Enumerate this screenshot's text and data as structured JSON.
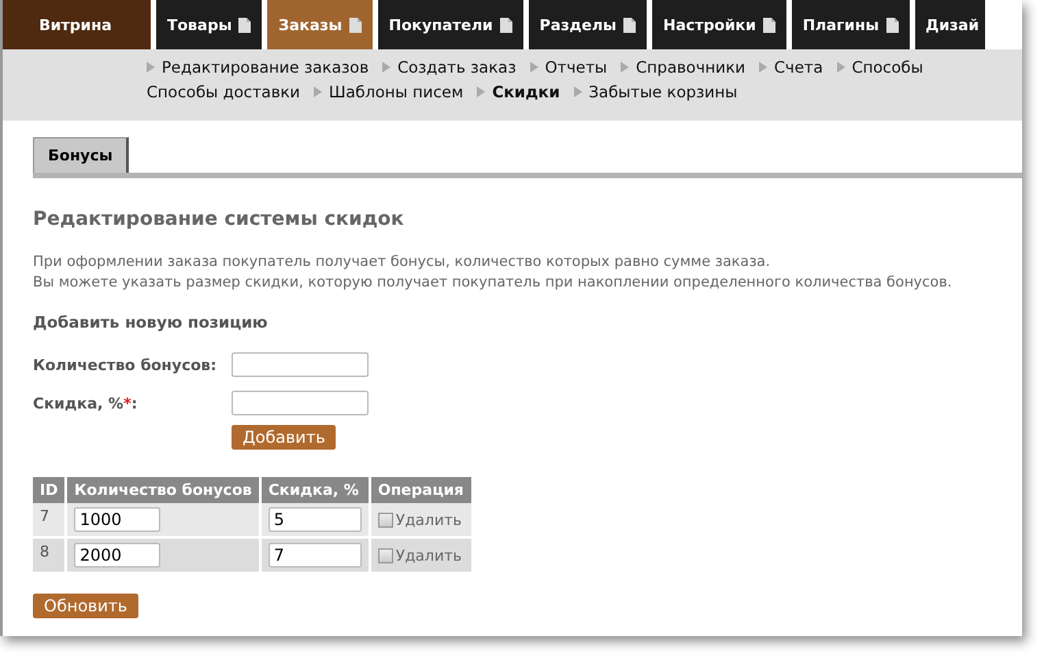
{
  "nav": [
    {
      "label": "Витрина",
      "kind": "home",
      "selected": false
    },
    {
      "label": "Товары",
      "kind": "menu",
      "selected": false
    },
    {
      "label": "Заказы",
      "kind": "menu",
      "selected": true
    },
    {
      "label": "Покупатели",
      "kind": "menu",
      "selected": false
    },
    {
      "label": "Разделы",
      "kind": "menu",
      "selected": false
    },
    {
      "label": "Настройки",
      "kind": "menu",
      "selected": false
    },
    {
      "label": "Плагины",
      "kind": "menu",
      "selected": false
    },
    {
      "label": "Дизай",
      "kind": "cut",
      "selected": false
    }
  ],
  "subnav": [
    [
      {
        "label": "Редактирование заказов",
        "arrow": true,
        "selected": false
      },
      {
        "label": "Создать заказ",
        "arrow": true,
        "selected": false
      },
      {
        "label": "Отчеты",
        "arrow": true,
        "selected": false
      },
      {
        "label": "Справочники",
        "arrow": true,
        "selected": false
      },
      {
        "label": "Счета",
        "arrow": true,
        "selected": false
      },
      {
        "label": "Способы",
        "arrow": true,
        "selected": false
      }
    ],
    [
      {
        "label": "Способы доставки",
        "arrow": false,
        "selected": false
      },
      {
        "label": "Шаблоны писем",
        "arrow": true,
        "selected": false
      },
      {
        "label": "Скидки",
        "arrow": true,
        "selected": true
      },
      {
        "label": "Забытые корзины",
        "arrow": true,
        "selected": false
      }
    ]
  ],
  "tabs": [
    {
      "label": "Бонусы",
      "selected": true
    }
  ],
  "heading": "Редактирование системы скидок",
  "description": [
    "При оформлении заказа покупатель получает бонусы, количество которых равно сумме заказа.",
    "Вы можете указать размер скидки, которую получает покупатель при накоплении определенного количества бонусов."
  ],
  "add_form": {
    "title": "Добавить новую позицию",
    "fields": [
      {
        "label": "Количество бонусов:",
        "required": false
      },
      {
        "label": "Скидка, %",
        "required": true,
        "label_end": ":"
      }
    ],
    "required_mark": "*",
    "button": "Добавить"
  },
  "table": {
    "columns": [
      "ID",
      "Количество бонусов",
      "Скидка, %",
      "Операция"
    ],
    "rows": [
      {
        "id": "7",
        "bonuses": "1000",
        "discount": "5",
        "delete_label": "Удалить",
        "checked": false
      },
      {
        "id": "8",
        "bonuses": "2000",
        "discount": "7",
        "delete_label": "Удалить",
        "checked": false
      }
    ]
  },
  "update_button": "Обновить"
}
